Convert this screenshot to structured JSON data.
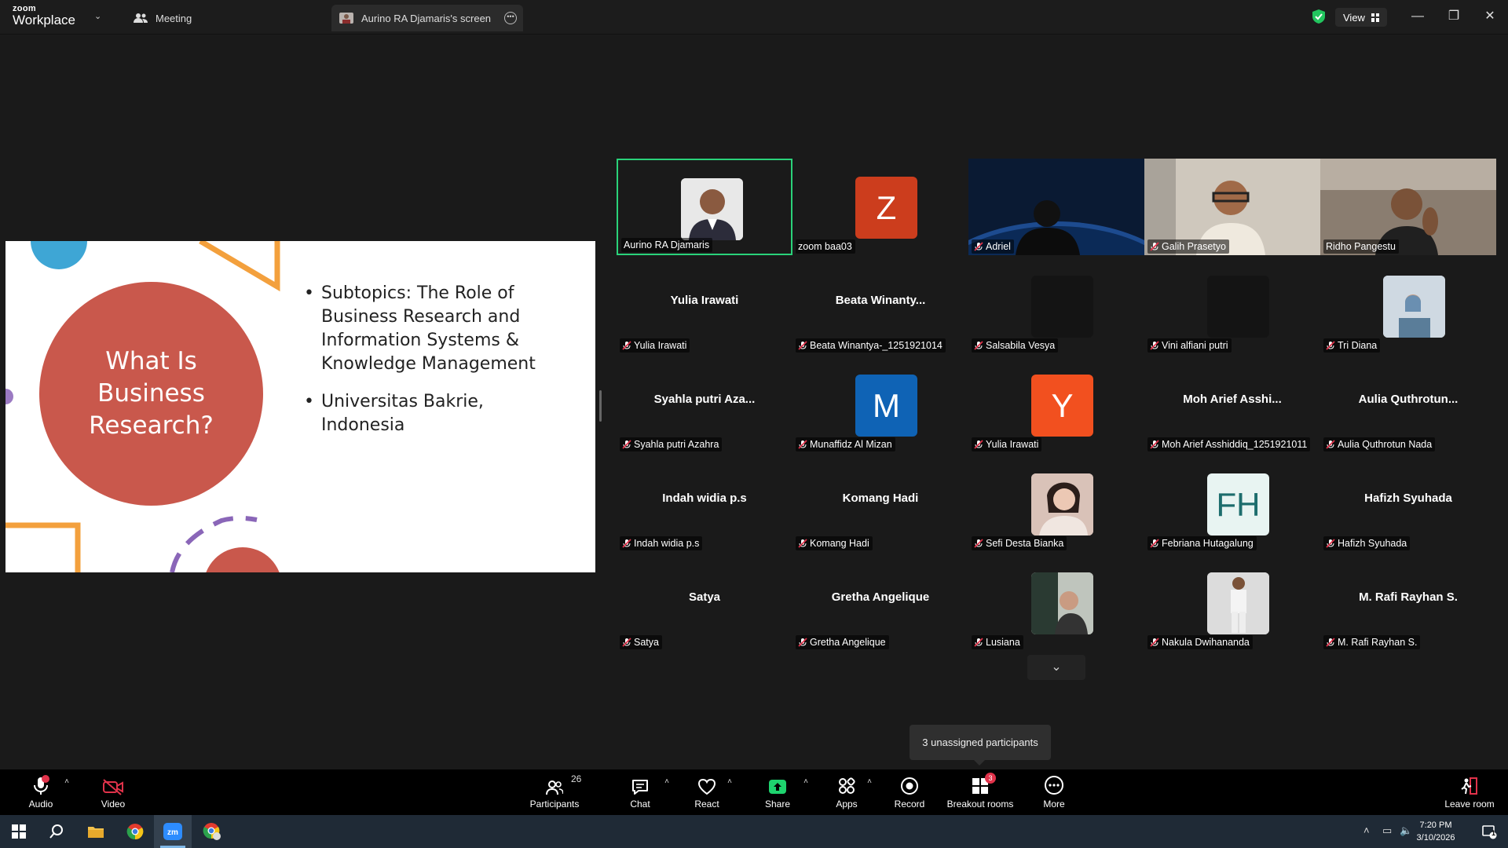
{
  "titlebar": {
    "logo_line1": "zoom",
    "logo_line2": "Workplace",
    "tab_meeting": "Meeting",
    "tab_screen": "Aurino RA Djamaris's screen",
    "view_label": "View"
  },
  "slide": {
    "title": "What Is\nBusiness\nResearch?",
    "bullets": [
      "Subtopics: The Role of Business Research and Information Systems & Knowledge Management",
      "Universitas Bakrie, Indonesia"
    ]
  },
  "participants": [
    {
      "label": "Aurino RA Djamaris",
      "muted": false,
      "kind": "photo",
      "speaking": true
    },
    {
      "label": "zoom baa03",
      "muted": false,
      "kind": "avatar",
      "avatar": "Z",
      "color": "#cc3d1d"
    },
    {
      "label": "Adriel",
      "muted": true,
      "kind": "video"
    },
    {
      "label": "Galih Prasetyo",
      "muted": true,
      "kind": "video"
    },
    {
      "label": "Ridho Pangestu",
      "muted": false,
      "kind": "video"
    },
    {
      "label": "Yulia Irawati",
      "muted": true,
      "kind": "name",
      "center": "Yulia Irawati"
    },
    {
      "label": "Beata Winantya-_1251921014",
      "muted": true,
      "kind": "name",
      "center": "Beata  Winanty..."
    },
    {
      "label": "Salsabila Vesya",
      "muted": true,
      "kind": "dark"
    },
    {
      "label": "Vini alfiani putri",
      "muted": true,
      "kind": "dark"
    },
    {
      "label": "Tri Diana",
      "muted": true,
      "kind": "photo"
    },
    {
      "label": "Syahla putri Azahra",
      "muted": true,
      "kind": "name",
      "center": "Syahla  putri  Aza..."
    },
    {
      "label": "Munaffidz Al Mizan",
      "muted": true,
      "kind": "avatar",
      "avatar": "M",
      "color": "#0f63b5"
    },
    {
      "label": "Yulia Irawati",
      "muted": true,
      "kind": "avatar",
      "avatar": "Y",
      "color": "#f2501f"
    },
    {
      "label": "Moh Arief Asshiddiq_1251921011",
      "muted": true,
      "kind": "name",
      "center": "Moh  Arief  Asshi..."
    },
    {
      "label": "Aulia Quthrotun Nada",
      "muted": true,
      "kind": "name",
      "center": "Aulia  Quthrotun..."
    },
    {
      "label": "Indah widia p.s",
      "muted": true,
      "kind": "name",
      "center": "Indah widia p.s"
    },
    {
      "label": "Komang Hadi",
      "muted": true,
      "kind": "name",
      "center": "Komang Hadi"
    },
    {
      "label": "Sefi Desta Bianka",
      "muted": true,
      "kind": "photo"
    },
    {
      "label": "Febriana Hutagalung",
      "muted": true,
      "kind": "avatar",
      "avatar": "FH",
      "color": "#e8f4f2",
      "fg": "#1d6d6d"
    },
    {
      "label": "Hafizh Syuhada",
      "muted": true,
      "kind": "name",
      "center": "Hafizh Syuhada"
    },
    {
      "label": "Satya",
      "muted": true,
      "kind": "name",
      "center": "Satya"
    },
    {
      "label": "Gretha Angelique",
      "muted": true,
      "kind": "name",
      "center": "Gretha Angelique"
    },
    {
      "label": "Lusiana",
      "muted": true,
      "kind": "photo"
    },
    {
      "label": "Nakula Dwihananda",
      "muted": true,
      "kind": "photo"
    },
    {
      "label": "M. Rafi Rayhan S.",
      "muted": true,
      "kind": "name",
      "center": "M. Rafi Rayhan S."
    }
  ],
  "unassigned_tooltip": "3 unassigned participants",
  "toolbar": {
    "audio": "Audio",
    "video": "Video",
    "participants": "Participants",
    "participants_count": "26",
    "chat": "Chat",
    "react": "React",
    "share": "Share",
    "apps": "Apps",
    "record": "Record",
    "breakout": "Breakout rooms",
    "breakout_badge": "3",
    "more": "More",
    "leave": "Leave room"
  },
  "taskbar": {
    "time": "7:20 PM",
    "date": "3/10/2026",
    "notification_count": "1"
  },
  "colors": {
    "speaking_border": "#2ad27a",
    "share_green": "#1ed36e",
    "mute_red": "#e0324a",
    "slide_circle": "#c9584c"
  }
}
